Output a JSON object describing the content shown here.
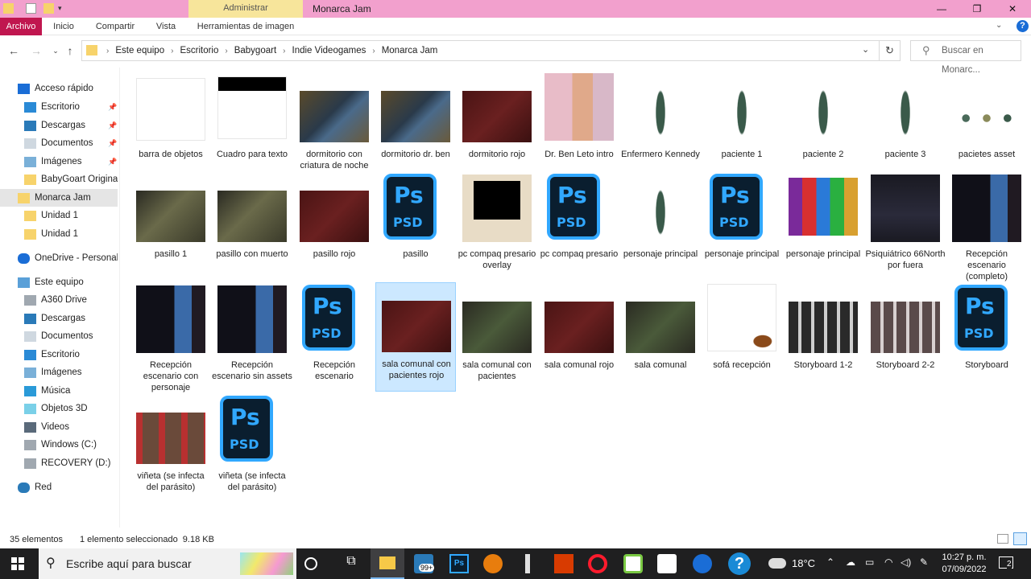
{
  "window": {
    "context_tab": "Administrar",
    "title": "Monarca Jam",
    "minimize_icon": "minimize-icon",
    "maximize_icon": "restore-icon",
    "close_icon": "close-icon"
  },
  "ribbon": {
    "tabs": [
      "Archivo",
      "Inicio",
      "Compartir",
      "Vista",
      "Herramientas de imagen"
    ],
    "accent": "#c0164f"
  },
  "address": {
    "crumbs": [
      "Este equipo",
      "Escritorio",
      "Babygoart",
      "Indie Videogames",
      "Monarca Jam"
    ],
    "search_placeholder": "Buscar en Monarc..."
  },
  "sidebar": {
    "items": [
      {
        "label": "Acceso rápido",
        "icon": "star-icon"
      },
      {
        "label": "Escritorio",
        "icon": "desktop-icon",
        "pinned": true
      },
      {
        "label": "Descargas",
        "icon": "download-icon",
        "pinned": true
      },
      {
        "label": "Documentos",
        "icon": "document-icon",
        "pinned": true
      },
      {
        "label": "Imágenes",
        "icon": "pictures-icon",
        "pinned": true
      },
      {
        "label": "BabyGoart Originals",
        "icon": "folder-icon"
      },
      {
        "label": "Monarca Jam",
        "icon": "folder-icon",
        "selected": true
      },
      {
        "label": "Unidad 1",
        "icon": "folder-icon"
      },
      {
        "label": "Unidad 1",
        "icon": "folder-icon"
      },
      {
        "label": "OneDrive - Personal",
        "icon": "cloud-icon"
      },
      {
        "label": "Este equipo",
        "icon": "computer-icon"
      },
      {
        "label": "A360 Drive",
        "icon": "drive-icon"
      },
      {
        "label": "Descargas",
        "icon": "download-icon"
      },
      {
        "label": "Documentos",
        "icon": "document-icon"
      },
      {
        "label": "Escritorio",
        "icon": "desktop-icon"
      },
      {
        "label": "Imágenes",
        "icon": "pictures-icon"
      },
      {
        "label": "Música",
        "icon": "music-icon"
      },
      {
        "label": "Objetos 3D",
        "icon": "cube-icon"
      },
      {
        "label": "Videos",
        "icon": "video-icon"
      },
      {
        "label": "Windows (C:)",
        "icon": "drive-icon"
      },
      {
        "label": "RECOVERY (D:)",
        "icon": "drive-icon"
      },
      {
        "label": "Red",
        "icon": "network-icon"
      }
    ]
  },
  "files": [
    {
      "name": "barra de objetos",
      "kind": "white-bar"
    },
    {
      "name": "Cuadro para texto",
      "kind": "white-topbar"
    },
    {
      "name": "dormitorio con criatura de noche",
      "kind": "bedroom"
    },
    {
      "name": "dormitorio dr. ben",
      "kind": "bedroom"
    },
    {
      "name": "dormitorio rojo",
      "kind": "red"
    },
    {
      "name": "Dr. Ben Leto intro",
      "kind": "portrait"
    },
    {
      "name": "Enfermero Kennedy",
      "kind": "sprite"
    },
    {
      "name": "paciente 1",
      "kind": "sprite"
    },
    {
      "name": "paciente 2",
      "kind": "sprite"
    },
    {
      "name": "paciente 3",
      "kind": "sprite"
    },
    {
      "name": "pacietes asset",
      "kind": "sprites"
    },
    {
      "name": "pasillo 1",
      "kind": "hall"
    },
    {
      "name": "pasillo con muerto",
      "kind": "hall"
    },
    {
      "name": "pasillo rojo",
      "kind": "red"
    },
    {
      "name": "pasillo",
      "kind": "psd"
    },
    {
      "name": "pc compaq presario overlay",
      "kind": "pc"
    },
    {
      "name": "pc compaq presario",
      "kind": "psd"
    },
    {
      "name": "personaje principal",
      "kind": "sprite"
    },
    {
      "name": "personaje principal",
      "kind": "psd"
    },
    {
      "name": "personaje principal",
      "kind": "rar"
    },
    {
      "name": "Psiquiátrico 66North por fuera",
      "kind": "night"
    },
    {
      "name": "Recepción escenario (completo)",
      "kind": "reception"
    },
    {
      "name": "Recepción escenario con personaje",
      "kind": "reception"
    },
    {
      "name": "Recepción escenario sin assets",
      "kind": "reception"
    },
    {
      "name": "Recepción escenario",
      "kind": "psd"
    },
    {
      "name": "sala comunal con pacientes rojo",
      "kind": "red",
      "selected": true
    },
    {
      "name": "sala comunal con pacientes",
      "kind": "room"
    },
    {
      "name": "sala comunal rojo",
      "kind": "red"
    },
    {
      "name": "sala comunal",
      "kind": "room"
    },
    {
      "name": "sofá recepción",
      "kind": "sofa"
    },
    {
      "name": "Storyboard 1-2",
      "kind": "board"
    },
    {
      "name": "Storyboard 2-2",
      "kind": "board2"
    },
    {
      "name": "Storyboard",
      "kind": "psd"
    },
    {
      "name": "viñeta (se infecta del parásito)",
      "kind": "comic"
    },
    {
      "name": "viñeta (se infecta del parásito)",
      "kind": "psd"
    }
  ],
  "psd_icon": {
    "line1": "Ps",
    "line2": "PSD"
  },
  "status": {
    "count": "35 elementos",
    "selection": "1 elemento seleccionado  9.18 KB"
  },
  "taskbar": {
    "search_placeholder": "Escribe aquí para buscar",
    "mail_badge": "99+",
    "temperature": "18°C",
    "time": "10:27 p. m.",
    "date": "07/09/2022",
    "notifications": "2"
  }
}
